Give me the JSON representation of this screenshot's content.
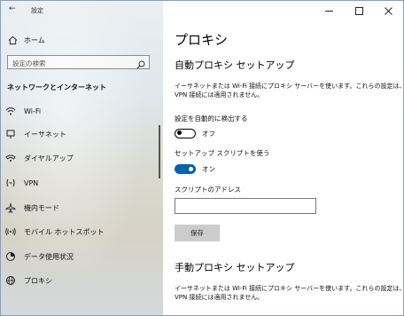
{
  "window": {
    "title": "設定",
    "controls": {
      "minimize": "—",
      "maximize": "☐",
      "close": "✕"
    }
  },
  "sidebar": {
    "home_label": "ホーム",
    "search_placeholder": "設定の検索",
    "section_title": "ネットワークとインターネット",
    "items": [
      {
        "label": "Wi-Fi",
        "icon": "wifi-icon"
      },
      {
        "label": "イーサネット",
        "icon": "ethernet-icon"
      },
      {
        "label": "ダイヤルアップ",
        "icon": "dialup-icon"
      },
      {
        "label": "VPN",
        "icon": "vpn-icon"
      },
      {
        "label": "機内モード",
        "icon": "airplane-icon"
      },
      {
        "label": "モバイル ホットスポット",
        "icon": "hotspot-icon"
      },
      {
        "label": "データ使用状況",
        "icon": "data-usage-icon"
      },
      {
        "label": "プロキシ",
        "icon": "globe-icon"
      }
    ]
  },
  "main": {
    "page_title": "プロキシ",
    "auto_section": {
      "title": "自動プロキシ セットアップ",
      "description": "イーサネットまたは Wi-Fi 接続にプロキシ サーバーを使います。これらの設定は、VPN 接続には適用されません。",
      "detect_label": "設定を自動的に検出する",
      "detect_state": "オフ",
      "script_label": "セットアップ スクリプトを使う",
      "script_state": "オン",
      "address_label": "スクリプトのアドレス",
      "address_value": "",
      "save_label": "保存"
    },
    "manual_section": {
      "title": "手動プロキシ セットアップ",
      "description": "イーサネットまたは Wi-Fi 接続にプロキシ サーバーを使います。これらの設定は、VPN 接続には適用されません。"
    }
  },
  "colors": {
    "accent": "#0063b1",
    "button": "#cccccc"
  }
}
